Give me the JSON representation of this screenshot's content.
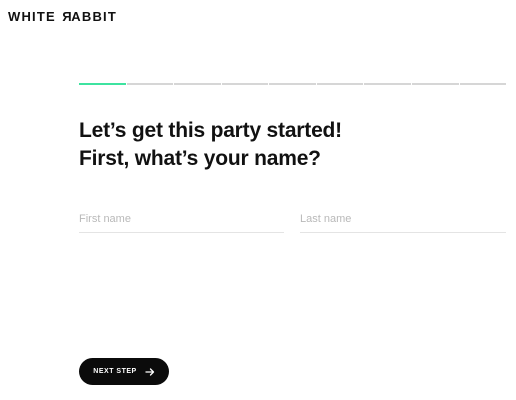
{
  "brand": {
    "logo_text_start": "WHITE ",
    "logo_text_reversed_letter": "R",
    "logo_text_end": "ABBIT"
  },
  "progress": {
    "total_steps": 9,
    "current_step": 1,
    "active_color": "#3ee3a0",
    "inactive_color": "#d6d6d6"
  },
  "heading": {
    "line1": "Let’s get this party started!",
    "line2": "First, what’s your name?"
  },
  "form": {
    "first_name": {
      "value": "",
      "placeholder": "First name"
    },
    "last_name": {
      "value": "",
      "placeholder": "Last name"
    }
  },
  "next_button": {
    "label": "NEXT STEP",
    "icon": "arrow-right-icon"
  }
}
